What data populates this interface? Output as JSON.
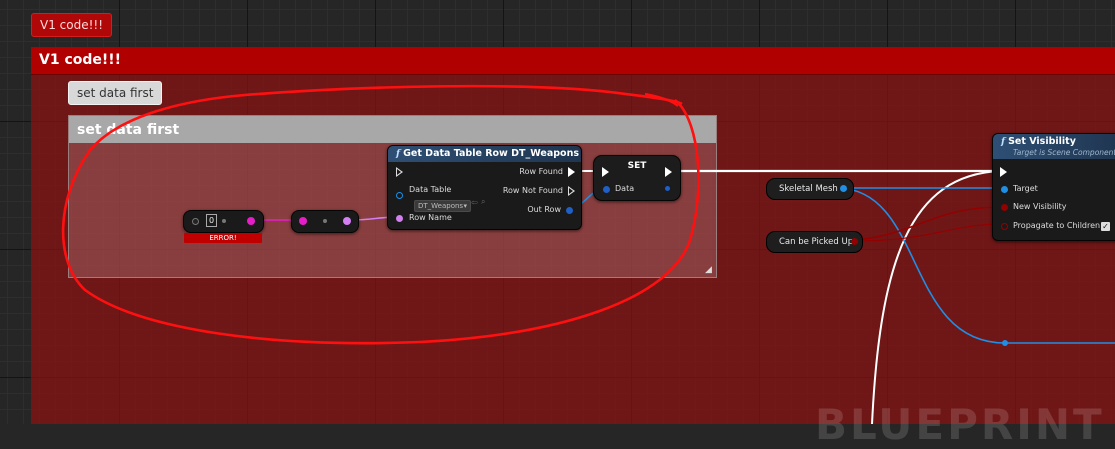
{
  "comments": {
    "outer_bubble": "V1 code!!!",
    "outer_title": "V1 code!!!",
    "inner_bubble": "set data first",
    "inner_title": "set data first"
  },
  "literal_node": {
    "value": "0",
    "error_badge": "ERROR!"
  },
  "get_row_node": {
    "title": "Get Data Table Row DT_Weapons",
    "data_table_label": "Data Table",
    "data_table_value": "DT_Weapons",
    "row_name_label": "Row Name",
    "row_found_label": "Row Found",
    "row_not_found_label": "Row Not Found",
    "out_row_label": "Out Row"
  },
  "set_node": {
    "title": "SET",
    "data_label": "Data"
  },
  "variables": {
    "skeletal_mesh": "Skeletal Mesh",
    "can_be_picked_up": "Can be Picked Up"
  },
  "set_visibility_node": {
    "title": "Set Visibility",
    "subtitle": "Target is Scene Component",
    "target_label": "Target",
    "new_visibility_label": "New Visibility",
    "propagate_label": "Propagate to Children",
    "propagate_checked": true
  },
  "watermark": "BLUEPRINT",
  "colors": {
    "exec_wire": "#ffffff",
    "object_wire": "#1e8fe6",
    "name_wire": "#d37ff2",
    "int_wire": "#e61ec8",
    "bool_wire": "#930000",
    "annotation": "#ff1a1a",
    "comment_outer": "#b00000",
    "comment_inner": "#a8a8a8"
  }
}
